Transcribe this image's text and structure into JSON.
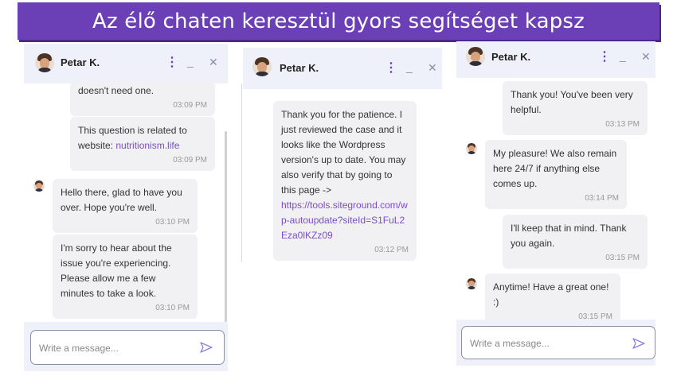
{
  "banner": {
    "title": "Az élő chaten keresztül gyors segítséget kapsz"
  },
  "colors": {
    "accent": "#6b3fb5",
    "header_bg": "#eef1fa",
    "bubble_bg": "#f1f1f4",
    "link": "#7a4cc9"
  },
  "panel1": {
    "agent_name": "Petar K.",
    "menu_icon": "kebab-icon",
    "minimize_icon": "minimize-icon",
    "close_icon": "close-icon",
    "messages": [
      {
        "text": "doesn't need one.",
        "time": "03:09 PM"
      },
      {
        "text": "This question is related to website: ",
        "link": "nutritionism.life",
        "time": "03:09 PM"
      },
      {
        "text": "Hello there, glad to have you over. Hope you're well.",
        "time": "03:10 PM"
      },
      {
        "text": "I'm sorry to hear about the issue you're experiencing. Please allow me a few minutes to take a look.",
        "time": "03:10 PM"
      }
    ],
    "input_placeholder": "Write a message...",
    "send_icon": "send-icon"
  },
  "panel2": {
    "agent_name": "Petar K.",
    "messages": [
      {
        "text": "Thank you for the patience. I just reviewed the case and it looks like the Wordpress version's up to date. You may also verify that by going to this page ->",
        "link": "https://tools.siteground.com/wp-autoupdate?siteId=S1FuL2Eza0lKZz09",
        "time": "03:12 PM"
      }
    ]
  },
  "panel3": {
    "agent_name": "Petar K.",
    "messages": [
      {
        "text": "Thank you! You've been very helpful.",
        "time": "03:13 PM"
      },
      {
        "text": "My pleasure! We also remain here 24/7 if anything else comes up.",
        "time": "03:14 PM"
      },
      {
        "text": "I'll keep that in mind. Thank you again.",
        "time": "03:15 PM"
      },
      {
        "text": "Anytime! Have a great one! :)",
        "time": "03:15 PM"
      }
    ],
    "input_placeholder": "Write a message..."
  }
}
